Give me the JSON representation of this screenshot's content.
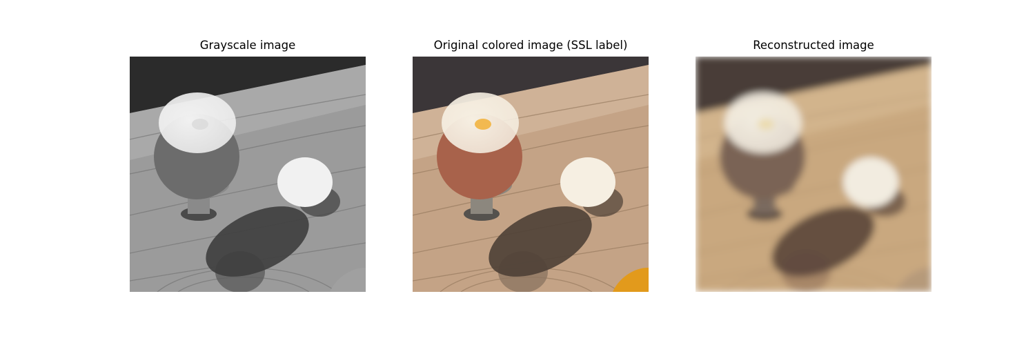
{
  "figure": {
    "panels": [
      {
        "title": "Grayscale image",
        "style": "grayscale"
      },
      {
        "title": "Original colored image (SSL label)",
        "style": "color"
      },
      {
        "title": "Reconstructed image",
        "style": "reconstructed"
      }
    ]
  },
  "palette": {
    "grayscale": {
      "wall": "#2b2b2b",
      "table": "#9b9b9b",
      "table_light": "#b4b4b4",
      "grain": "#6f6f6f",
      "shell": "#6c6c6c",
      "white": "#f1f1f1",
      "yolk": "#dcdcdc",
      "cup": "#8a8a8a",
      "cup_dark": "#4a4a4a",
      "shadow": "#3e3e3e",
      "knot": "#5d5d5d",
      "crumbs": "#a0a0a0"
    },
    "color": {
      "wall": "#3b3638",
      "table": "#c4a386",
      "table_light": "#d9bfa6",
      "grain": "#8f7358",
      "shell": "#a8624b",
      "white": "#f6efe2",
      "yolk": "#f2b440",
      "cup": "#8c877e",
      "cup_dark": "#55524e",
      "shadow": "#4e4036",
      "knot": "#8d7561",
      "crumbs": "#e29a1c"
    },
    "reconstructed": {
      "wall": "#4a3d38",
      "table": "#c9a87f",
      "table_light": "#d8bd97",
      "grain": "#9a7a5a",
      "shell": "#7a6354",
      "white": "#f2ece0",
      "yolk": "#ead9a8",
      "cup": "#7a6a5e",
      "cup_dark": "#5a4b42",
      "shadow": "#5a463b",
      "knot": "#a07e61",
      "crumbs": "#b69a7a"
    }
  }
}
